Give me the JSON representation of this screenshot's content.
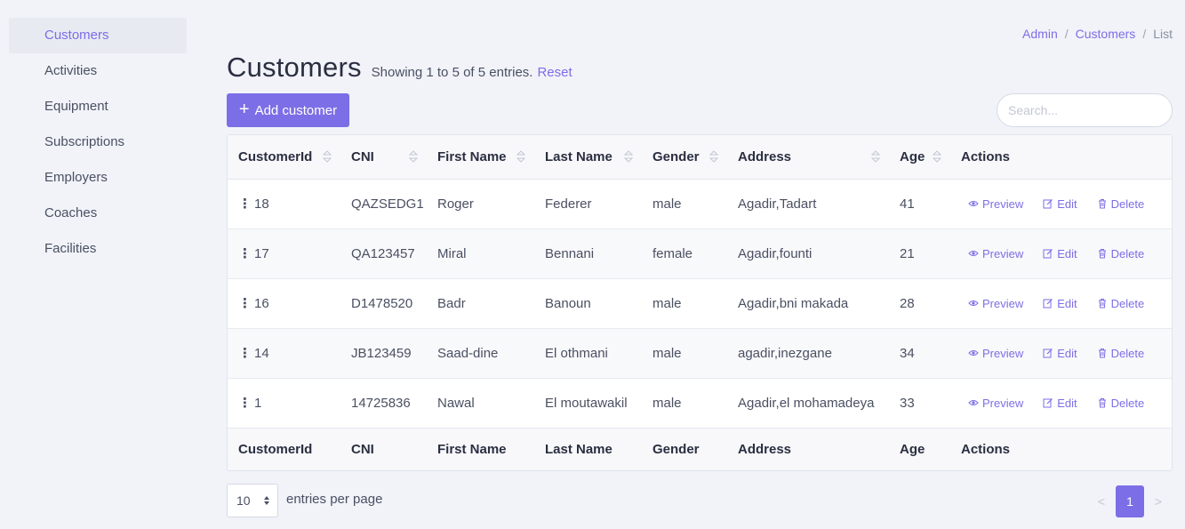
{
  "sidebar": {
    "items": [
      {
        "label": "Customers",
        "active": true
      },
      {
        "label": "Activities"
      },
      {
        "label": "Equipment"
      },
      {
        "label": "Subscriptions"
      },
      {
        "label": "Employers"
      },
      {
        "label": "Coaches"
      },
      {
        "label": "Facilities"
      }
    ]
  },
  "breadcrumb": {
    "admin": "Admin",
    "customers": "Customers",
    "current": "List",
    "separator": "/"
  },
  "header": {
    "title": "Customers",
    "entries_info": "Showing 1 to 5 of 5 entries.",
    "reset": "Reset"
  },
  "toolbar": {
    "add_label": "Add customer",
    "add_icon": "+",
    "search_placeholder": "Search..."
  },
  "table": {
    "columns": [
      "CustomerId",
      "CNI",
      "First Name",
      "Last Name",
      "Gender",
      "Address",
      "Age",
      "Actions"
    ],
    "rows": [
      {
        "id": "18",
        "cni": "QAZSEDG1",
        "first": "Roger",
        "last": "Federer",
        "gender": "male",
        "address": "Agadir,Tadart",
        "age": "41"
      },
      {
        "id": "17",
        "cni": "QA123457",
        "first": "Miral",
        "last": "Bennani",
        "gender": "female",
        "address": "Agadir,founti",
        "age": "21"
      },
      {
        "id": "16",
        "cni": "D1478520",
        "first": "Badr",
        "last": "Banoun",
        "gender": "male",
        "address": "Agadir,bni makada",
        "age": "28"
      },
      {
        "id": "14",
        "cni": "JB123459",
        "first": "Saad-dine",
        "last": "El othmani",
        "gender": "male",
        "address": "agadir,inezgane",
        "age": "34"
      },
      {
        "id": "1",
        "cni": "14725836",
        "first": "Nawal",
        "last": "El moutawakil",
        "gender": "male",
        "address": "Agadir,el mohamadeya",
        "age": "33"
      }
    ],
    "actions": {
      "preview": "Preview",
      "edit": "Edit",
      "delete": "Delete"
    },
    "row_menu_icon": "⋮"
  },
  "pagination": {
    "per_page": "10",
    "per_page_label": "entries per page",
    "prev": "<",
    "next": ">",
    "current_page": "1"
  },
  "colors": {
    "accent": "#7c6ee6",
    "background": "#f1f3f9"
  }
}
